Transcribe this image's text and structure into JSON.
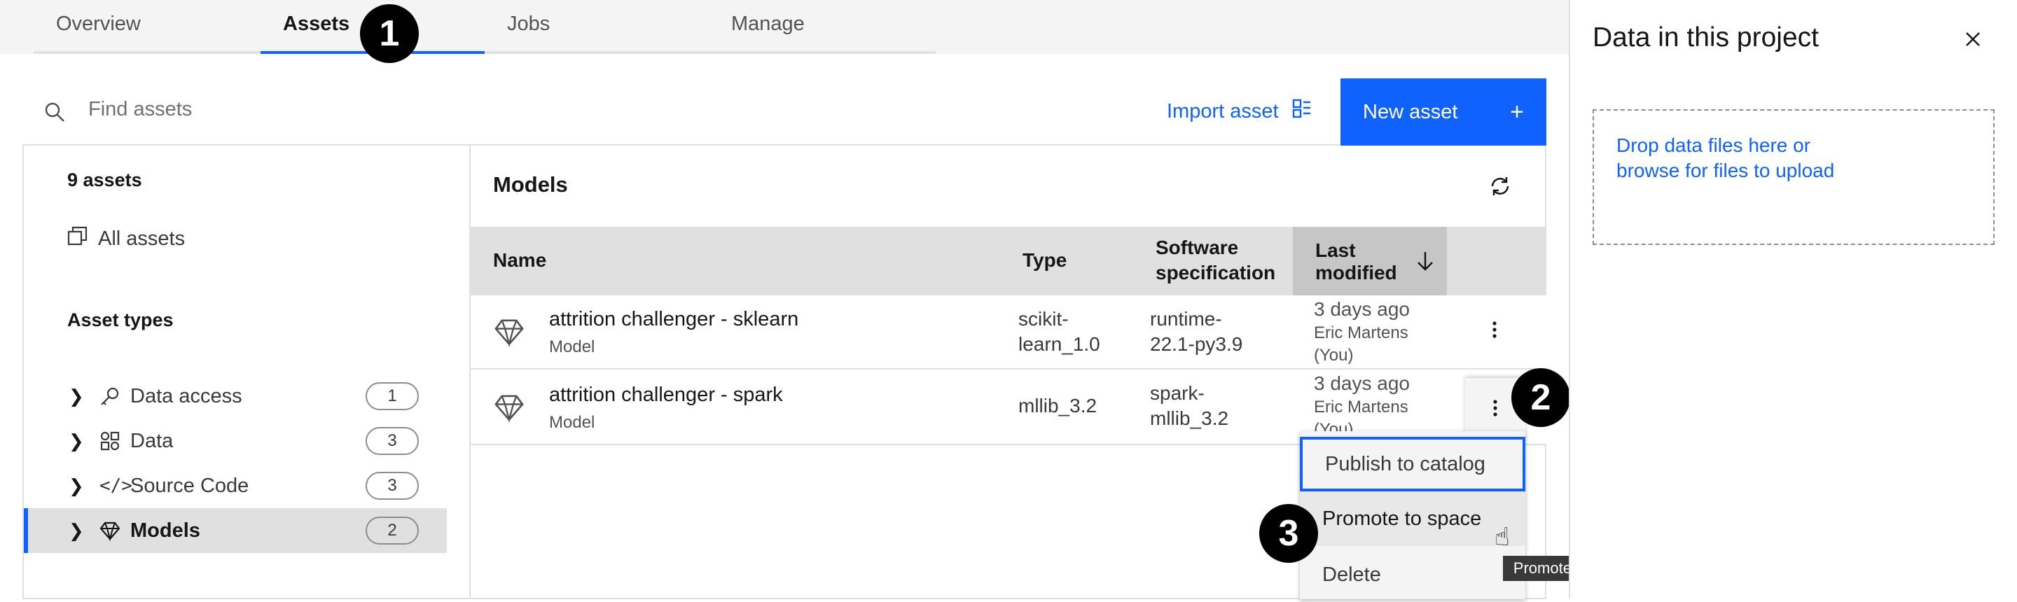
{
  "tabs": [
    {
      "label": "Overview"
    },
    {
      "label": "Assets"
    },
    {
      "label": "Jobs"
    },
    {
      "label": "Manage"
    }
  ],
  "callouts": {
    "one": "1",
    "two": "2",
    "three": "3"
  },
  "search": {
    "placeholder": "Find assets"
  },
  "toolbar": {
    "import_label": "Import asset",
    "new_label": "New asset",
    "new_icon": "+"
  },
  "sidebar": {
    "count": "9 assets",
    "all_assets": "All assets",
    "types_heading": "Asset types",
    "categories": [
      {
        "label": "Data access",
        "count": "1",
        "icon": "key-icon"
      },
      {
        "label": "Data",
        "count": "3",
        "icon": "data-icon"
      },
      {
        "label": "Source Code",
        "count": "3",
        "icon": "code-icon"
      },
      {
        "label": "Models",
        "count": "2",
        "icon": "model-icon"
      }
    ]
  },
  "models": {
    "title": "Models",
    "columns": {
      "name": "Name",
      "type": "Type",
      "software1": "Software",
      "software2": "specification",
      "modified1": "Last",
      "modified2": "modified"
    },
    "rows": [
      {
        "name": "attrition challenger - sklearn",
        "kind": "Model",
        "type1": "scikit-",
        "type2": "learn_1.0",
        "sw1": "runtime-",
        "sw2": "22.1-py3.9",
        "mod1": "3 days ago",
        "mod2": "Eric Martens",
        "mod3": "(You)"
      },
      {
        "name": "attrition challenger - spark",
        "kind": "Model",
        "type1": "mllib_3.2",
        "type2": "",
        "sw1": "spark-",
        "sw2": "mllib_3.2",
        "mod1": "3 days ago",
        "mod2": "Eric Martens",
        "mod3": "(You)"
      }
    ]
  },
  "menu": {
    "items": [
      "Publish to catalog",
      "Promote to space",
      "Delete"
    ],
    "tooltip": "Promote to space"
  },
  "panel": {
    "title": "Data in this project",
    "drop1": "Drop data files here or",
    "drop2": "browse for files to upload"
  },
  "colors": {
    "accent": "#0f62fe",
    "selected_bg": "#e0e0e0"
  }
}
